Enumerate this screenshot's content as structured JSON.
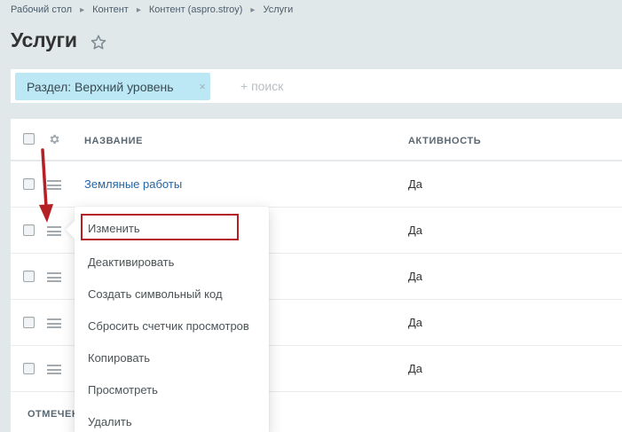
{
  "breadcrumb": [
    "Рабочий стол",
    "Контент",
    "Контент (aspro.stroy)",
    "Услуги"
  ],
  "page": {
    "title": "Услуги"
  },
  "filter": {
    "tag_label": "Раздел: Верхний уровень",
    "tag_close": "×",
    "search_placeholder": "+ поиск"
  },
  "grid": {
    "columns": {
      "name": "НАЗВАНИЕ",
      "active": "АКТИВНОСТЬ"
    },
    "rows": [
      {
        "name": "Земляные работы",
        "active": "Да"
      },
      {
        "name": "",
        "active": "Да"
      },
      {
        "name": "",
        "active": "Да"
      },
      {
        "name": "",
        "active": "Да"
      },
      {
        "name": "",
        "active": "Да"
      }
    ],
    "footer_label": "ОТМЕЧЕН"
  },
  "context_menu": {
    "items": [
      "Изменить",
      "Деактивировать",
      "Создать символьный код",
      "Сбросить счетчик просмотров",
      "Копировать",
      "Просмотреть",
      "Удалить"
    ]
  },
  "icons": {
    "star": "star-icon",
    "gear": "gear-icon",
    "row_menu": "hamburger-icon",
    "annotation": "red-arrow"
  },
  "colors": {
    "link": "#2466a6",
    "filter_tag_bg": "#bce8f5",
    "annotation_red": "#b42025",
    "page_bg": "#e1e8ea"
  }
}
